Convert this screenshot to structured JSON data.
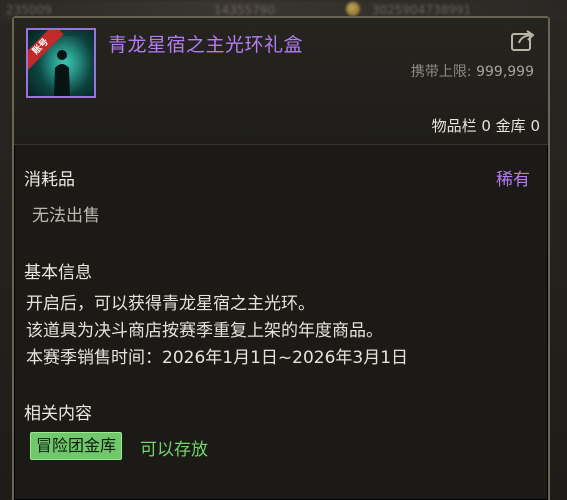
{
  "background_strip": {
    "text_left": "235009",
    "text_mid": "14355790",
    "text_right": "3025904738991"
  },
  "item": {
    "name": "青龙星宿之主光环礼盒",
    "badge": "账号",
    "carry_limit_label": "携带上限:",
    "carry_limit_value": "999,999",
    "storage_text": "物品栏 0 金库 0",
    "category": "消耗品",
    "rarity": "稀有",
    "sell_status": "无法出售"
  },
  "basic_info": {
    "title": "基本信息",
    "lines": [
      "开启后，可以获得青龙星宿之主光环。",
      "该道具为决斗商店按赛季重复上架的年度商品。",
      "本赛季销售时间：2026年1月1日~2026年3月1日"
    ]
  },
  "related": {
    "title": "相关内容",
    "button_label": "冒险团金库",
    "status": "可以存放"
  },
  "colors": {
    "rare_purple": "#b57cf2",
    "green_accent": "#6fc86a"
  },
  "icons": {
    "share": "share-icon",
    "item": "item-icon"
  }
}
